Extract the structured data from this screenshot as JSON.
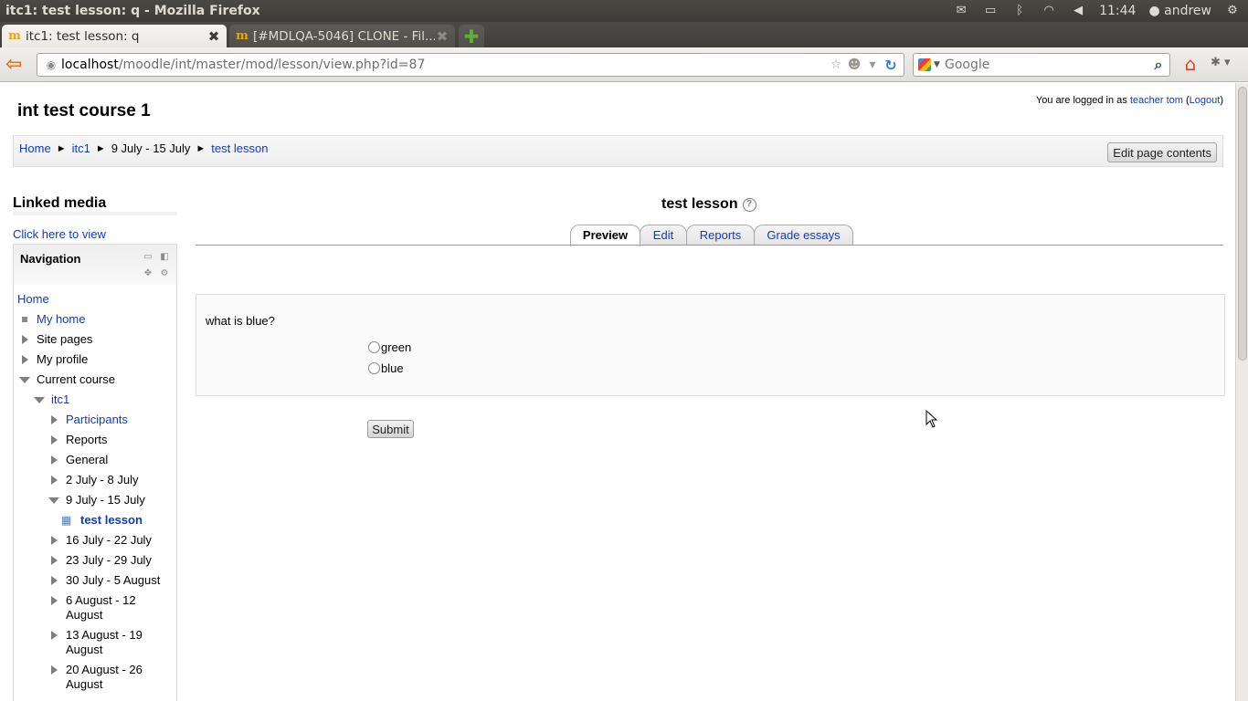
{
  "window": {
    "title": "itc1: test lesson: q - Mozilla Firefox"
  },
  "tray": {
    "time": "11:44",
    "user": "andrew"
  },
  "tabs": [
    {
      "label": "itc1: test lesson: q",
      "favicon": "m"
    },
    {
      "label": "[#MDLQA-5046] CLONE - Fil...",
      "favicon": "m"
    }
  ],
  "urlbar": {
    "host": "localhost",
    "path": "/moodle/int/master/mod/lesson/view.php?id=87"
  },
  "search": {
    "placeholder": "Google"
  },
  "page": {
    "course_title": "int test course 1",
    "login": {
      "prefix": "You are logged in as ",
      "user": "teacher tom",
      "open": " (",
      "logout": "Logout",
      "close": ")"
    },
    "breadcrumb": [
      "Home",
      "itc1",
      "9 July - 15 July",
      "test lesson"
    ],
    "breadcrumb_sep": "►",
    "edit_button": "Edit page contents"
  },
  "linked_media": {
    "title": "Linked media",
    "link": "Click here to view"
  },
  "navigation": {
    "title": "Navigation",
    "items": [
      {
        "label": "Home"
      },
      {
        "label": "My home"
      },
      {
        "label": "Site pages"
      },
      {
        "label": "My profile"
      },
      {
        "label": "Current course"
      },
      {
        "label": "itc1"
      },
      {
        "label": "Participants"
      },
      {
        "label": "Reports"
      },
      {
        "label": "General"
      },
      {
        "label": "2 July - 8 July"
      },
      {
        "label": "9 July - 15 July"
      },
      {
        "label": "test lesson"
      },
      {
        "label": "16 July - 22 July"
      },
      {
        "label": "23 July - 29 July"
      },
      {
        "label": "30 July - 5 August"
      },
      {
        "label": "6 August - 12 August"
      },
      {
        "label": "13 August - 19 August"
      },
      {
        "label": "20 August - 26 August"
      }
    ]
  },
  "lesson": {
    "title": "test lesson",
    "tabs": [
      "Preview",
      "Edit",
      "Reports",
      "Grade essays"
    ],
    "question": "what is blue?",
    "answers": [
      "green",
      "blue"
    ],
    "submit": "Submit"
  }
}
